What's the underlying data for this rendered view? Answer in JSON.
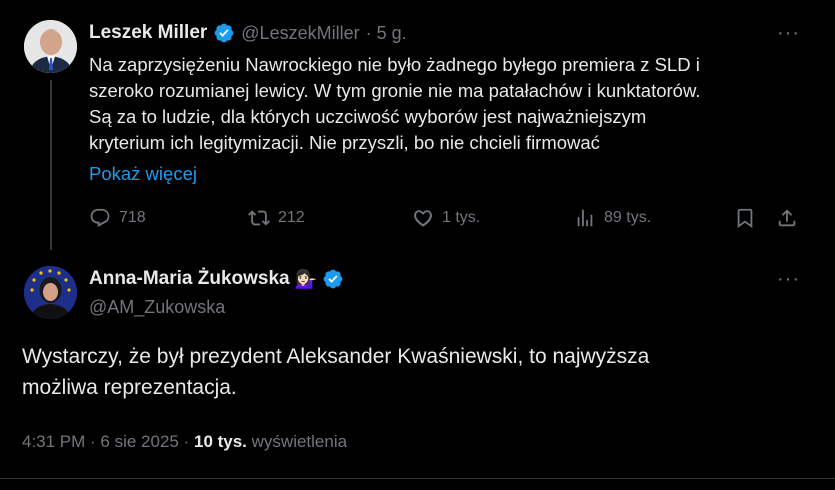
{
  "colors": {
    "background": "#000000",
    "text": "#e7e9ea",
    "muted": "#71767b",
    "link": "#1d9bf0",
    "verified": "#1d9bf0"
  },
  "tweet": {
    "author_name": "Leszek Miller",
    "handle": "@LeszekMiller",
    "time": "· 5 g.",
    "text_lines": [
      "Na zaprzysiężeniu Nawrockiego nie było żadnego byłego premiera z SLD i",
      "szeroko rozumianej lewicy. W tym gronie nie ma patałachów i kunktatorów.",
      "Są za to ludzie, dla których uczciwość wyborów jest najważniejszym",
      "kryterium ich legitymizacji. Nie przyszli, bo nie chcieli firmować"
    ],
    "show_more": "Pokaż więcej",
    "more_menu": "···",
    "actions": {
      "replies": "718",
      "reposts": "212",
      "likes": "1 tys.",
      "views": "89 tys."
    }
  },
  "reply": {
    "author_name": "Anna-Maria Żukowska",
    "name_emoji": "💁🏻‍♀️",
    "handle": "@AM_Zukowska",
    "more_menu": "···",
    "text_lines": [
      "Wystarczy, że był prezydent Aleksander Kwaśniewski, to najwyższa",
      "możliwa reprezentacja."
    ],
    "meta": {
      "time": "4:31 PM · 6 sie 2025 · ",
      "views_count": "10 tys.",
      "views_label": " wyświetlenia"
    }
  },
  "icons": [
    "reply-icon",
    "repost-icon",
    "like-icon",
    "views-icon",
    "bookmark-icon",
    "share-icon",
    "verified-icon"
  ]
}
